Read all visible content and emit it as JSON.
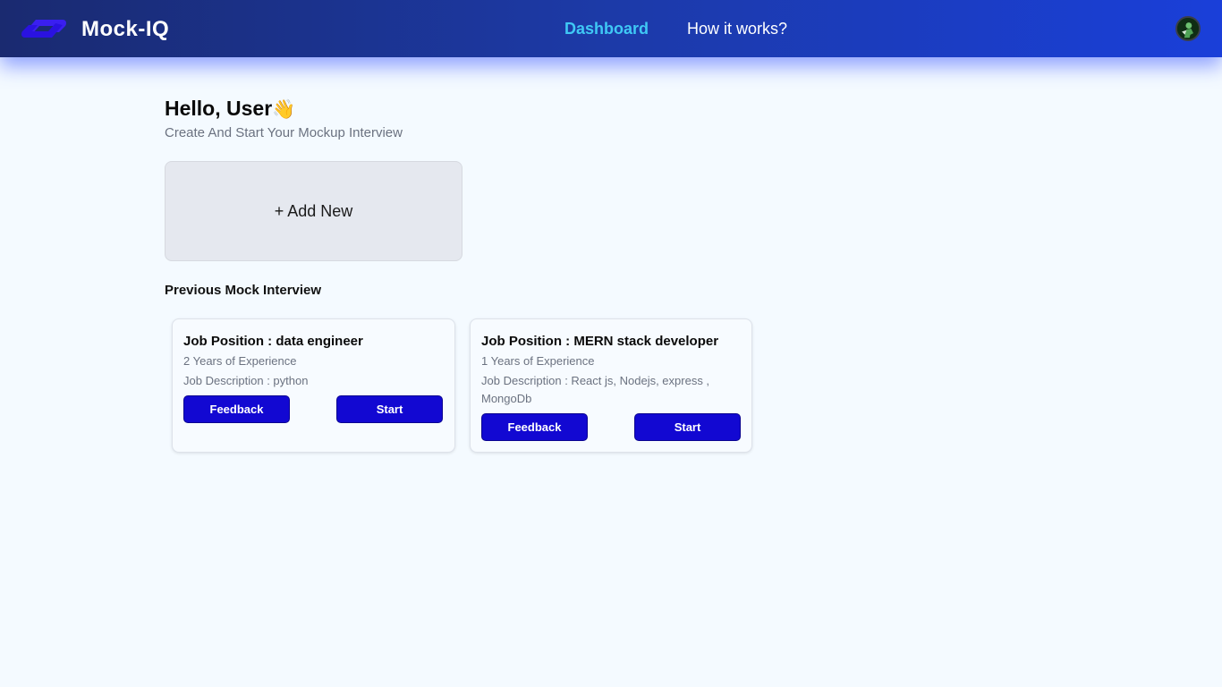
{
  "header": {
    "brand": "Mock-IQ",
    "nav": [
      {
        "label": "Dashboard",
        "active": true
      },
      {
        "label": "How it works?",
        "active": false
      }
    ],
    "gradient": [
      "#1a2a70",
      "#1a3fd9"
    ],
    "active_link_color": "#3fc8f5"
  },
  "main": {
    "greeting": "Hello, User",
    "greeting_emoji": "👋",
    "subtitle": "Create And Start Your Mockup Interview",
    "add_new_label": "+ Add New",
    "previous_title": "Previous Mock Interview"
  },
  "interviews": [
    {
      "position": "Job Position : data engineer",
      "experience": "2 Years of Experience",
      "description": "Job Description : python",
      "feedback_label": "Feedback",
      "start_label": "Start"
    },
    {
      "position": "Job Position : MERN stack developer",
      "experience": "1 Years of Experience",
      "description": "Job Description : React js, Nodejs, express , MongoDb",
      "feedback_label": "Feedback",
      "start_label": "Start"
    }
  ],
  "colors": {
    "background": "#f4faff",
    "button": "#1208d2",
    "card": "#f7fbff",
    "add_card": "#e5e8ef"
  },
  "icons": {
    "logo": "brand-logo-icon",
    "avatar": "user-avatar"
  }
}
